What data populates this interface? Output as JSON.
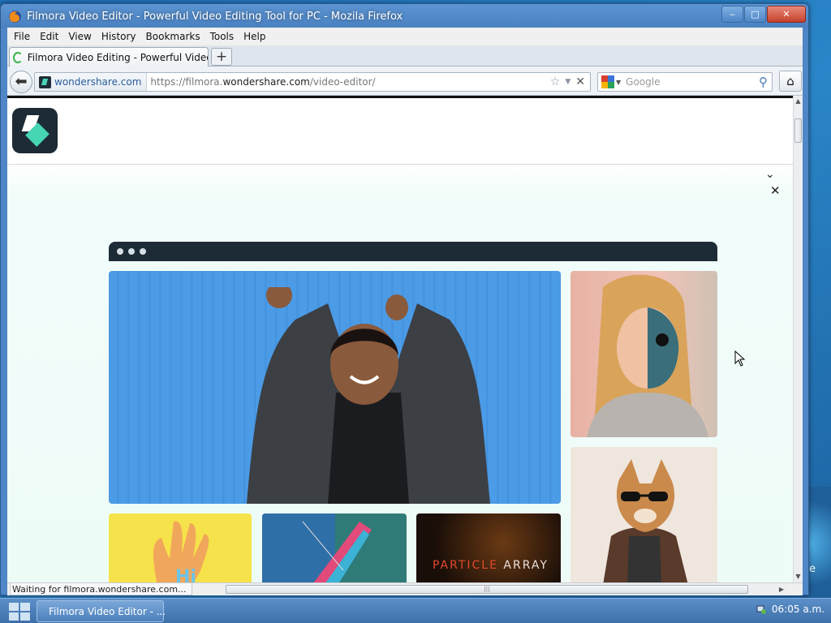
{
  "window": {
    "title": "Filmora Video Editor - Powerful Video Editing Tool for PC - Mozila Firefox",
    "buttons": {
      "minimize": "‒",
      "maximize": "□",
      "close": "✕"
    }
  },
  "menubar": {
    "items": [
      "File",
      "Edit",
      "View",
      "History",
      "Bookmarks",
      "Tools",
      "Help"
    ]
  },
  "tabs": {
    "active_label": "Filmora Video Editing - Powerful Video Editing ...",
    "new_tab_label": "+"
  },
  "navbar": {
    "identity": "wondershare.com",
    "url_prefix": "https://filmora.",
    "url_domain": "wondershare.com",
    "url_path": "/video-editor/",
    "search_placeholder": "Google"
  },
  "page": {
    "particle_text_1": "PARTICLE",
    "particle_text_2": "ARRAY",
    "accent_color": "#46d6b4",
    "dark_color": "#1c2b36"
  },
  "statusbar": {
    "text": "Waiting for filmora.wondershare.com..."
  },
  "taskbar": {
    "task_label": "Filmora Video Editor - ...",
    "clock": "06:05 a.m."
  },
  "desktop": {
    "edge_text": "e"
  }
}
